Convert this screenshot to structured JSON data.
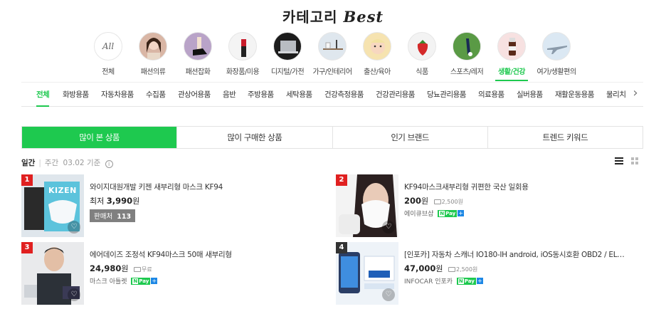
{
  "header": {
    "title_ko": "카테고리",
    "title_en": "Best"
  },
  "categories": [
    {
      "label": "전체",
      "icon": "all-text",
      "icon_text": "All"
    },
    {
      "label": "패션의류",
      "icon": "woman-portrait-icon"
    },
    {
      "label": "패션잡화",
      "icon": "shoe-icon"
    },
    {
      "label": "화장품/미용",
      "icon": "lipstick-icon"
    },
    {
      "label": "디지털/가전",
      "icon": "laptop-icon"
    },
    {
      "label": "가구/인테리어",
      "icon": "shelf-icon"
    },
    {
      "label": "출산/육아",
      "icon": "baby-icon"
    },
    {
      "label": "식품",
      "icon": "strawberry-icon"
    },
    {
      "label": "스포츠/레저",
      "icon": "golf-icon"
    },
    {
      "label": "생활/건강",
      "icon": "health-bottle-icon"
    },
    {
      "label": "여가/생활편의",
      "icon": "airplane-icon"
    }
  ],
  "subcategories": [
    "전체",
    "화방용품",
    "자동차용품",
    "수집품",
    "관상어용품",
    "음반",
    "주방용품",
    "세탁용품",
    "건강측정용품",
    "건강관리용품",
    "당뇨관리용품",
    "의료용품",
    "실버용품",
    "재활운동용품",
    "물리치"
  ],
  "tabs": [
    "많이 본 상품",
    "많이 구매한 상품",
    "인기 브랜드",
    "트렌드 키워드"
  ],
  "filter": {
    "daily": "일간",
    "weekly": "주간",
    "date_note": "03.02 기준",
    "info": "i"
  },
  "products": [
    {
      "rank": "1",
      "name": "와이지대원개발 키젠 새부리형 마스크 KF94",
      "price_prefix": "최저",
      "price": "3,990",
      "unit": "원",
      "seller_label": "판매처",
      "seller_count": "113",
      "thumb_text": "KIZEN"
    },
    {
      "rank": "2",
      "name": "KF94마스크새부리형 귀편한 국산 일회용",
      "price": "200",
      "unit": "원",
      "shipping": "2,500원",
      "store": "에이큐브샵",
      "npay": "Pay"
    },
    {
      "rank": "3",
      "name": "에어데이즈 조정석 KF94마스크 50매 새부리형",
      "price": "24,980",
      "unit": "원",
      "shipping": "무료",
      "store": "마스크 아틀렛",
      "npay": "Pay"
    },
    {
      "rank": "4",
      "name": "[인포카] 자동차 스캐너 IO180-IH android, iOS동시호환 OBD2 / EL…",
      "price": "47,000",
      "unit": "원",
      "shipping": "2,500원",
      "store": "INFOCAR 인포카",
      "npay": "Pay"
    }
  ],
  "colors": {
    "accent": "#1ec94f",
    "rank_red": "#e02020",
    "rank_dark": "#333333"
  }
}
